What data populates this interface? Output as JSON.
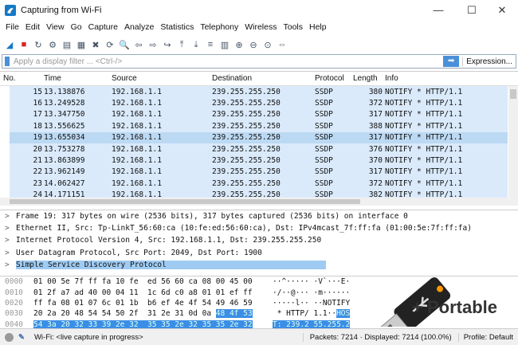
{
  "window": {
    "title": "Capturing from Wi-Fi",
    "minimize": "—",
    "maximize": "☐",
    "close": "✕"
  },
  "menu": [
    "File",
    "Edit",
    "View",
    "Go",
    "Capture",
    "Analyze",
    "Statistics",
    "Telephony",
    "Wireless",
    "Tools",
    "Help"
  ],
  "toolbar_icons": [
    "shark-fin-start-icon",
    "stop-icon",
    "restart-icon",
    "options-icon",
    "open-icon",
    "save-icon",
    "close-file-icon",
    "reload-icon",
    "find-icon",
    "back-icon",
    "forward-icon",
    "go-to-packet-icon",
    "first-packet-icon",
    "last-packet-icon",
    "autoscroll-icon",
    "colorize-icon",
    "zoom-in-icon",
    "zoom-out-icon",
    "normal-size-icon",
    "resize-columns-icon"
  ],
  "filter": {
    "placeholder": "Apply a display filter ... <Ctrl-/>",
    "expression": "Expression...",
    "apply": "➡"
  },
  "columns": [
    "No.",
    "Time",
    "Source",
    "Destination",
    "Protocol",
    "Length",
    "Info"
  ],
  "packets": [
    [
      "15",
      "13.138876",
      "192.168.1.1",
      "239.255.255.250",
      "SSDP",
      "380",
      "NOTIFY * HTTP/1.1"
    ],
    [
      "16",
      "13.249528",
      "192.168.1.1",
      "239.255.255.250",
      "SSDP",
      "372",
      "NOTIFY * HTTP/1.1"
    ],
    [
      "17",
      "13.347750",
      "192.168.1.1",
      "239.255.255.250",
      "SSDP",
      "317",
      "NOTIFY * HTTP/1.1"
    ],
    [
      "18",
      "13.556625",
      "192.168.1.1",
      "239.255.255.250",
      "SSDP",
      "388",
      "NOTIFY * HTTP/1.1"
    ],
    [
      "19",
      "13.655034",
      "192.168.1.1",
      "239.255.255.250",
      "SSDP",
      "317",
      "NOTIFY * HTTP/1.1"
    ],
    [
      "20",
      "13.753278",
      "192.168.1.1",
      "239.255.255.250",
      "SSDP",
      "376",
      "NOTIFY * HTTP/1.1"
    ],
    [
      "21",
      "13.863899",
      "192.168.1.1",
      "239.255.255.250",
      "SSDP",
      "370",
      "NOTIFY * HTTP/1.1"
    ],
    [
      "22",
      "13.962149",
      "192.168.1.1",
      "239.255.255.250",
      "SSDP",
      "317",
      "NOTIFY * HTTP/1.1"
    ],
    [
      "23",
      "14.062427",
      "192.168.1.1",
      "239.255.255.250",
      "SSDP",
      "372",
      "NOTIFY * HTTP/1.1"
    ],
    [
      "24",
      "14.171151",
      "192.168.1.1",
      "239.255.255.250",
      "SSDP",
      "382",
      "NOTIFY * HTTP/1.1"
    ]
  ],
  "selected_packet": "19",
  "details": [
    "Frame 19: 317 bytes on wire (2536 bits), 317 bytes captured (2536 bits) on interface 0",
    "Ethernet II, Src: Tp-LinkT_56:60:ca (10:fe:ed:56:60:ca), Dst: IPv4mcast_7f:ff:fa (01:00:5e:7f:ff:fa)",
    "Internet Protocol Version 4, Src: 192.168.1.1, Dst: 239.255.255.250",
    "User Datagram Protocol, Src Port: 2049, Dst Port: 1900",
    "Simple Service Discovery Protocol"
  ],
  "hex": [
    {
      "offset": "0000",
      "bytes": "01 00 5e 7f ff fa 10 fe  ed 56 60 ca 08 00 45 00",
      "hl_bytes": "",
      "ascii": "··^····· ·V`···E·",
      "hl_ascii": ""
    },
    {
      "offset": "0010",
      "bytes": "01 2f a7 ad 40 00 04 11  1c 6d c0 a8 01 01 ef ff",
      "hl_bytes": "",
      "ascii": "·/··@··· ·m······",
      "hl_ascii": ""
    },
    {
      "offset": "0020",
      "bytes": "ff fa 08 01 07 6c 01 1b  b6 ef 4e 4f 54 49 46 59",
      "hl_bytes": "",
      "ascii": "·····l·· ··NOTIFY",
      "hl_ascii": ""
    },
    {
      "offset": "0030",
      "bytes": "20 2a 20 48 54 54 50 2f  31 2e 31 0d 0a ",
      "hl_bytes": "48 4f 53",
      "ascii": " * HTTP/ 1.1··",
      "hl_ascii": "HOS"
    },
    {
      "offset": "0040",
      "bytes": "",
      "hl_bytes": "54 3a 20 32 33 39 2e 32  35 35 2e 32 35 35 2e 32",
      "ascii": "",
      "hl_ascii": "T: 239.2 55.255.2"
    }
  ],
  "overlay": {
    "label": "+ Portable"
  },
  "status": {
    "capture": "Wi-Fi: <live capture in progress>",
    "packets": "Packets: 7214 · Displayed: 7214 (100.0%)",
    "profile": "Profile: Default"
  }
}
